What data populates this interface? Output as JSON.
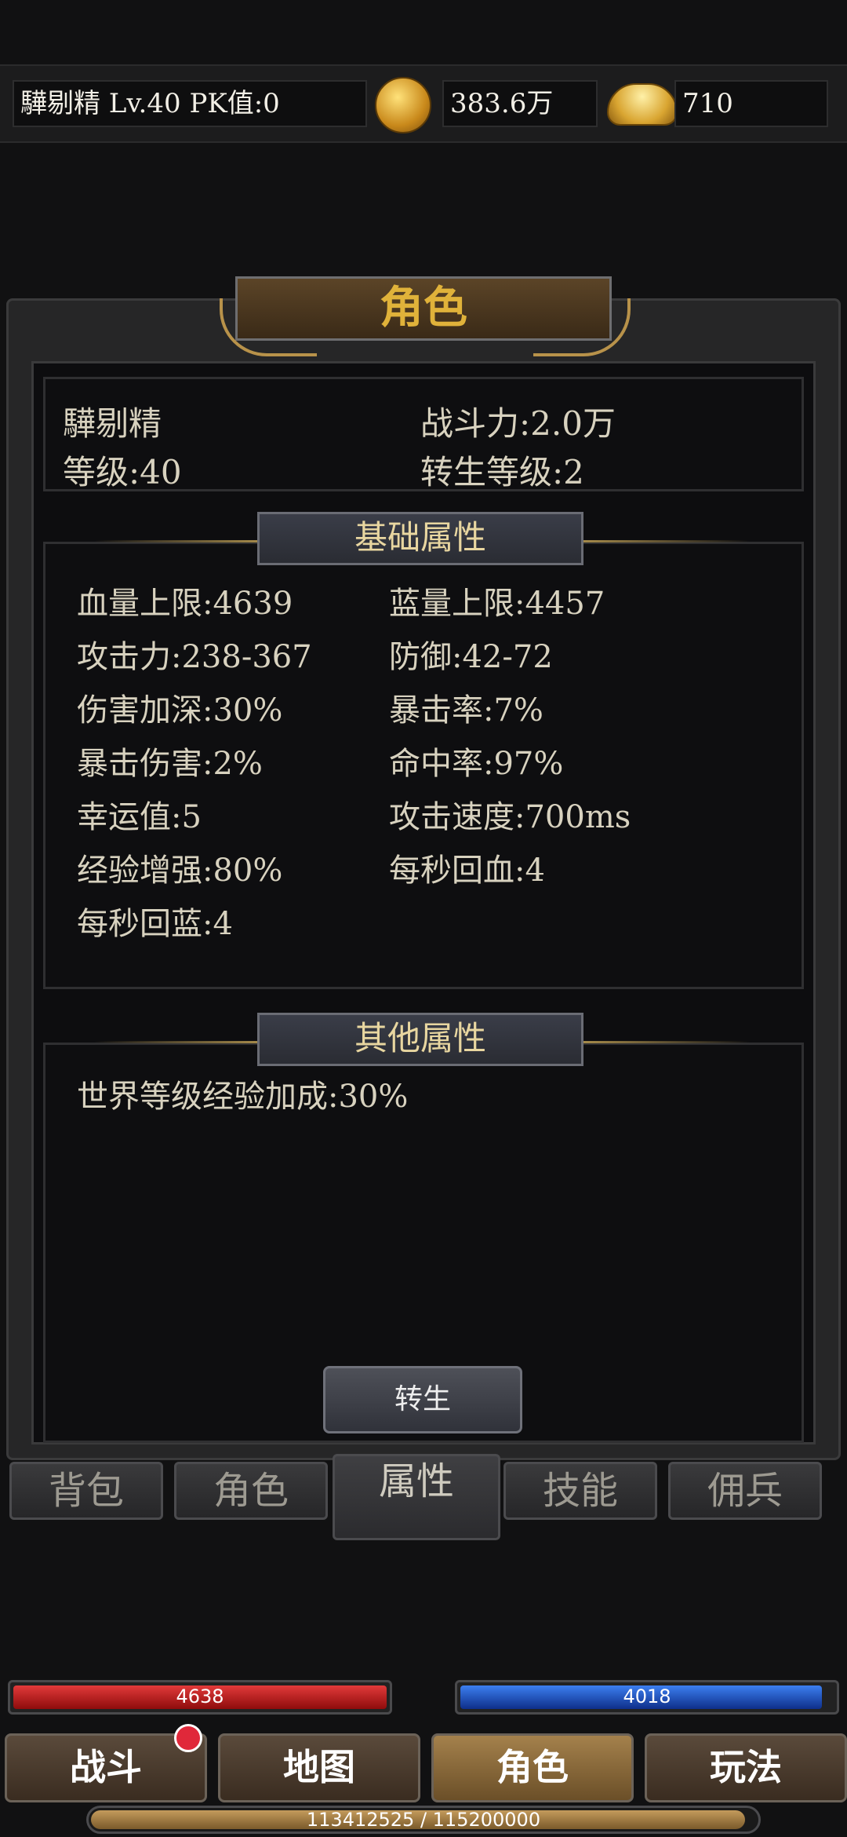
{
  "header": {
    "player_info": "驊剔精  Lv.40 PK值:0",
    "gold_amount": "383.6万",
    "ingot_amount": "710"
  },
  "panel": {
    "title": "角色",
    "name": "驊剔精",
    "power": "战斗力:2.0万",
    "level": "等级:40",
    "rebirth_level": "转生等级:2"
  },
  "basic": {
    "title": "基础属性",
    "left": [
      "血量上限:4639",
      "攻击力:238-367",
      "伤害加深:30%",
      "暴击伤害:2%",
      "幸运值:5",
      "经验增强:80%",
      "每秒回蓝:4"
    ],
    "right": [
      "蓝量上限:4457",
      "防御:42-72",
      "暴击率:7%",
      "命中率:97%",
      "攻击速度:700ms",
      "每秒回血:4"
    ]
  },
  "other": {
    "title": "其他属性",
    "items": [
      "世界等级经验加成:30%"
    ]
  },
  "rebirth_button": "转生",
  "subtabs": [
    "背包",
    "角色",
    "属性",
    "技能",
    "佣兵"
  ],
  "active_subtab": 2,
  "hp": {
    "value": "4638",
    "fill": 1.0
  },
  "mp": {
    "value": "4018",
    "fill": 0.97
  },
  "nav": [
    "战斗",
    "地图",
    "角色",
    "玩法"
  ],
  "active_nav": 2,
  "exp": {
    "text": "113412525 / 115200000",
    "fill": 0.984
  },
  "colors": {
    "accent_gold": "#e0b23a",
    "hp_red": "#c01818",
    "mp_blue": "#1a55c8",
    "badge_red": "#e0283a"
  }
}
